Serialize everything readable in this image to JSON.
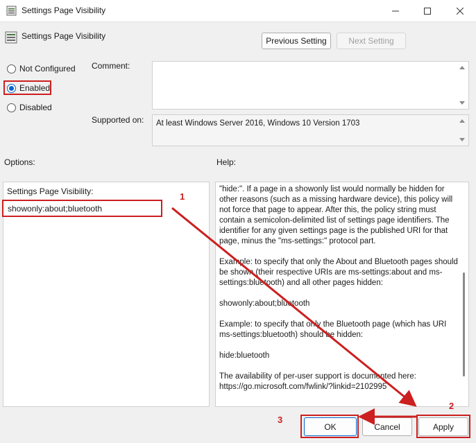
{
  "window": {
    "title": "Settings Page Visibility",
    "minimize_icon": "minimize-icon",
    "maximize_icon": "maximize-icon",
    "close_icon": "close-icon"
  },
  "header": {
    "title": "Settings Page Visibility",
    "previous_label": "Previous Setting",
    "next_label": "Next Setting"
  },
  "state": {
    "options": [
      {
        "label": "Not Configured",
        "checked": false
      },
      {
        "label": "Enabled",
        "checked": true
      },
      {
        "label": "Disabled",
        "checked": false
      }
    ]
  },
  "comment": {
    "label": "Comment:",
    "value": ""
  },
  "supported": {
    "label": "Supported on:",
    "value": "At least Windows Server 2016, Windows 10 Version 1703"
  },
  "options_panel": {
    "label": "Options:",
    "field_label": "Settings Page Visibility:",
    "field_value": "showonly:about;bluetooth"
  },
  "help": {
    "label": "Help:",
    "paragraphs": [
      "\"hide:\". If a page in a showonly list would normally be hidden for other reasons (such as a missing hardware device), this policy will not force that page to appear. After this, the policy string must contain a semicolon-delimited list of settings page identifiers. The identifier for any given settings page is the published URI for that page, minus the \"ms-settings:\" protocol part.",
      "Example: to specify that only the About and Bluetooth pages should be shown (their respective URIs are ms-settings:about and ms-settings:bluetooth) and all other pages hidden:",
      "showonly:about;bluetooth",
      "Example: to specify that only the Bluetooth page (which has URI ms-settings:bluetooth) should be hidden:",
      "hide:bluetooth",
      "The availability of per-user support is documented here: https://go.microsoft.com/fwlink/?linkid=2102995"
    ]
  },
  "footer": {
    "ok_label": "OK",
    "cancel_label": "Cancel",
    "apply_label": "Apply"
  },
  "annotations": {
    "step1": "1",
    "step2": "2",
    "step3": "3",
    "highlight_color": "#cc1f1f"
  }
}
